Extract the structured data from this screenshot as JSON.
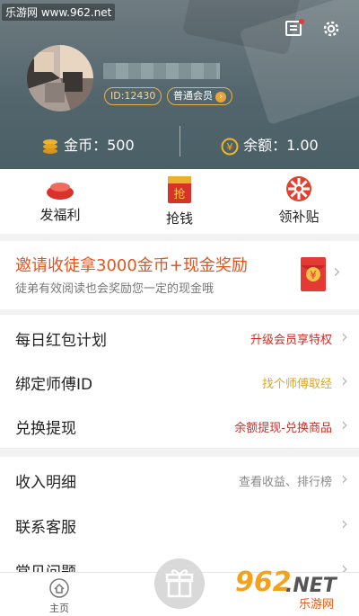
{
  "watermark": "乐游网 www.962.net",
  "header": {
    "user_id": "ID:12430",
    "member_level": "普通会员",
    "coins_label": "金币：500",
    "balance_label": "余额：1.00",
    "icons": [
      "message-icon",
      "settings-gear-icon"
    ]
  },
  "quick_actions": [
    {
      "label": "发福利",
      "icon": "red-envelope-icon"
    },
    {
      "label": "抢钱",
      "icon": "grab-money-icon",
      "badge": "抢"
    },
    {
      "label": "领补贴",
      "icon": "subsidy-wheel-icon"
    }
  ],
  "banner": {
    "title": "邀请收徒拿3000金币+现金奖励",
    "subtitle": "徒弟有效阅读也会奖励您一定的现金哦",
    "envelope_symbol": "¥"
  },
  "rows": [
    {
      "label": "每日红包计划",
      "right": "升级会员享特权"
    },
    {
      "label": "绑定师傅ID",
      "right": "找个师傅取经"
    },
    {
      "label": "兑换提现",
      "right": "余额提现-兑换商品"
    },
    {
      "label": "收入明细",
      "right": "查看收益、排行榜"
    },
    {
      "label": "联系客服",
      "right": ""
    },
    {
      "label": "常见问题",
      "right": ""
    }
  ],
  "colors": {
    "accent_red": "#c8312a",
    "accent_orange": "#e4541c",
    "accent_gold": "#e0a51c",
    "muted": "#888888"
  },
  "tabbar": {
    "home_label": "主页",
    "gift_icon": "gift-icon"
  },
  "brand": {
    "logo": "962",
    "suffix": ".NET",
    "cn": "乐游网"
  }
}
